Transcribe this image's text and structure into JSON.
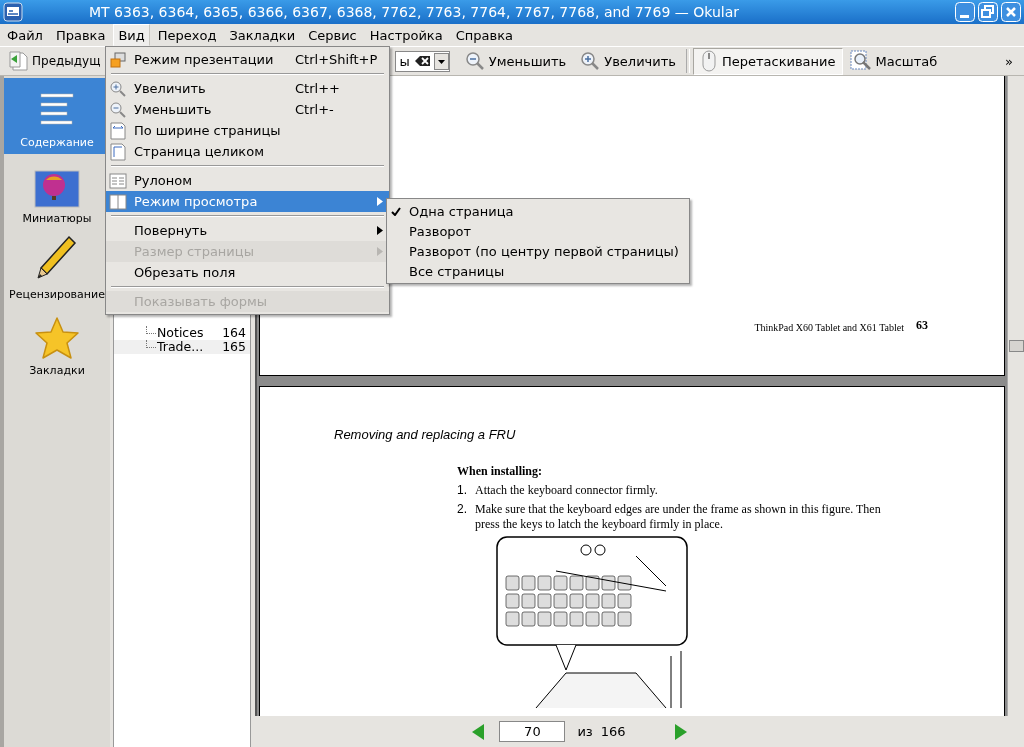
{
  "window": {
    "title": "MT 6363, 6364, 6365, 6366, 6367, 6368, 7762, 7763, 7764, 7767, 7768, and 7769 — Okular"
  },
  "menubar": {
    "items": [
      {
        "label": "Файл",
        "selected": false
      },
      {
        "label": "Правка",
        "selected": false
      },
      {
        "label": "Вид",
        "selected": true
      },
      {
        "label": "Переход",
        "selected": false
      },
      {
        "label": "Закладки",
        "selected": false
      },
      {
        "label": "Сервис",
        "selected": false
      },
      {
        "label": "Настройка",
        "selected": false
      },
      {
        "label": "Справка",
        "selected": false
      }
    ]
  },
  "toolbar": {
    "items": [
      {
        "kind": "button",
        "label": "Предыдущ"
      },
      {
        "kind": "combo",
        "value": "ы"
      },
      {
        "kind": "button",
        "label": "Уменьшить"
      },
      {
        "kind": "button",
        "label": "Увеличить"
      },
      {
        "kind": "toggle",
        "label": "Перетаскивание",
        "selected": true
      },
      {
        "kind": "toggle",
        "label": "Масштаб",
        "selected": false
      },
      {
        "kind": "overflow",
        "label": "»"
      }
    ]
  },
  "sidebar": {
    "items": [
      {
        "label": "Содержание",
        "selected": true
      },
      {
        "label": "Миниатюры",
        "selected": false
      },
      {
        "label": "Рецензирование",
        "selected": false
      },
      {
        "label": "Закладки",
        "selected": false
      }
    ]
  },
  "contents_tree": {
    "rows": [
      {
        "title": "Notices",
        "page": "164"
      },
      {
        "title": "Trade...",
        "page": "165"
      }
    ]
  },
  "view_menu": {
    "items": [
      {
        "kind": "item",
        "label": "Режим презентации",
        "shortcut": "Ctrl+Shift+P",
        "disabled": false,
        "selected": false
      },
      {
        "kind": "separator"
      },
      {
        "kind": "item",
        "label": "Увеличить",
        "shortcut": "Ctrl++",
        "disabled": false,
        "selected": false
      },
      {
        "kind": "item",
        "label": "Уменьшить",
        "shortcut": "Ctrl+-",
        "disabled": false,
        "selected": false
      },
      {
        "kind": "item",
        "label": "По ширине страницы",
        "disabled": false,
        "selected": false
      },
      {
        "kind": "item",
        "label": "Страница целиком",
        "disabled": false,
        "selected": false
      },
      {
        "kind": "separator"
      },
      {
        "kind": "item",
        "label": "Рулоном",
        "disabled": false,
        "selected": false
      },
      {
        "kind": "submenu",
        "label": "Режим просмотра",
        "disabled": false,
        "selected": true
      },
      {
        "kind": "separator"
      },
      {
        "kind": "submenu",
        "label": "Повернуть",
        "disabled": false,
        "selected": false
      },
      {
        "kind": "submenu",
        "label": "Размер страницы",
        "disabled": true,
        "selected": false
      },
      {
        "kind": "item",
        "label": "Обрезать поля",
        "disabled": false,
        "selected": false
      },
      {
        "kind": "separator"
      },
      {
        "kind": "item",
        "label": "Показывать формы",
        "disabled": true,
        "selected": false
      }
    ]
  },
  "view_mode_submenu": {
    "items": [
      {
        "label": "Одна страница",
        "checked": true
      },
      {
        "label": "Разворот",
        "checked": false
      },
      {
        "label": "Разворот (по центру первой страницы)",
        "checked": false
      },
      {
        "label": "Все страницы",
        "checked": false
      }
    ]
  },
  "document": {
    "page_footer": {
      "title": "ThinkPad X60 Tablet and X61 Tablet",
      "number": "63"
    },
    "section_heading": "Removing and replacing a FRU",
    "subheading": "When installing:",
    "steps": [
      {
        "number": "1.",
        "text": "Attach the keyboard connector firmly."
      },
      {
        "number": "2.",
        "text": "Make sure that the keyboard edges are under the frame as shown in this figure. Then press the keys to latch the keyboard firmly in place."
      }
    ]
  },
  "page_nav": {
    "current": "70",
    "of_label": "из",
    "total": "166"
  }
}
